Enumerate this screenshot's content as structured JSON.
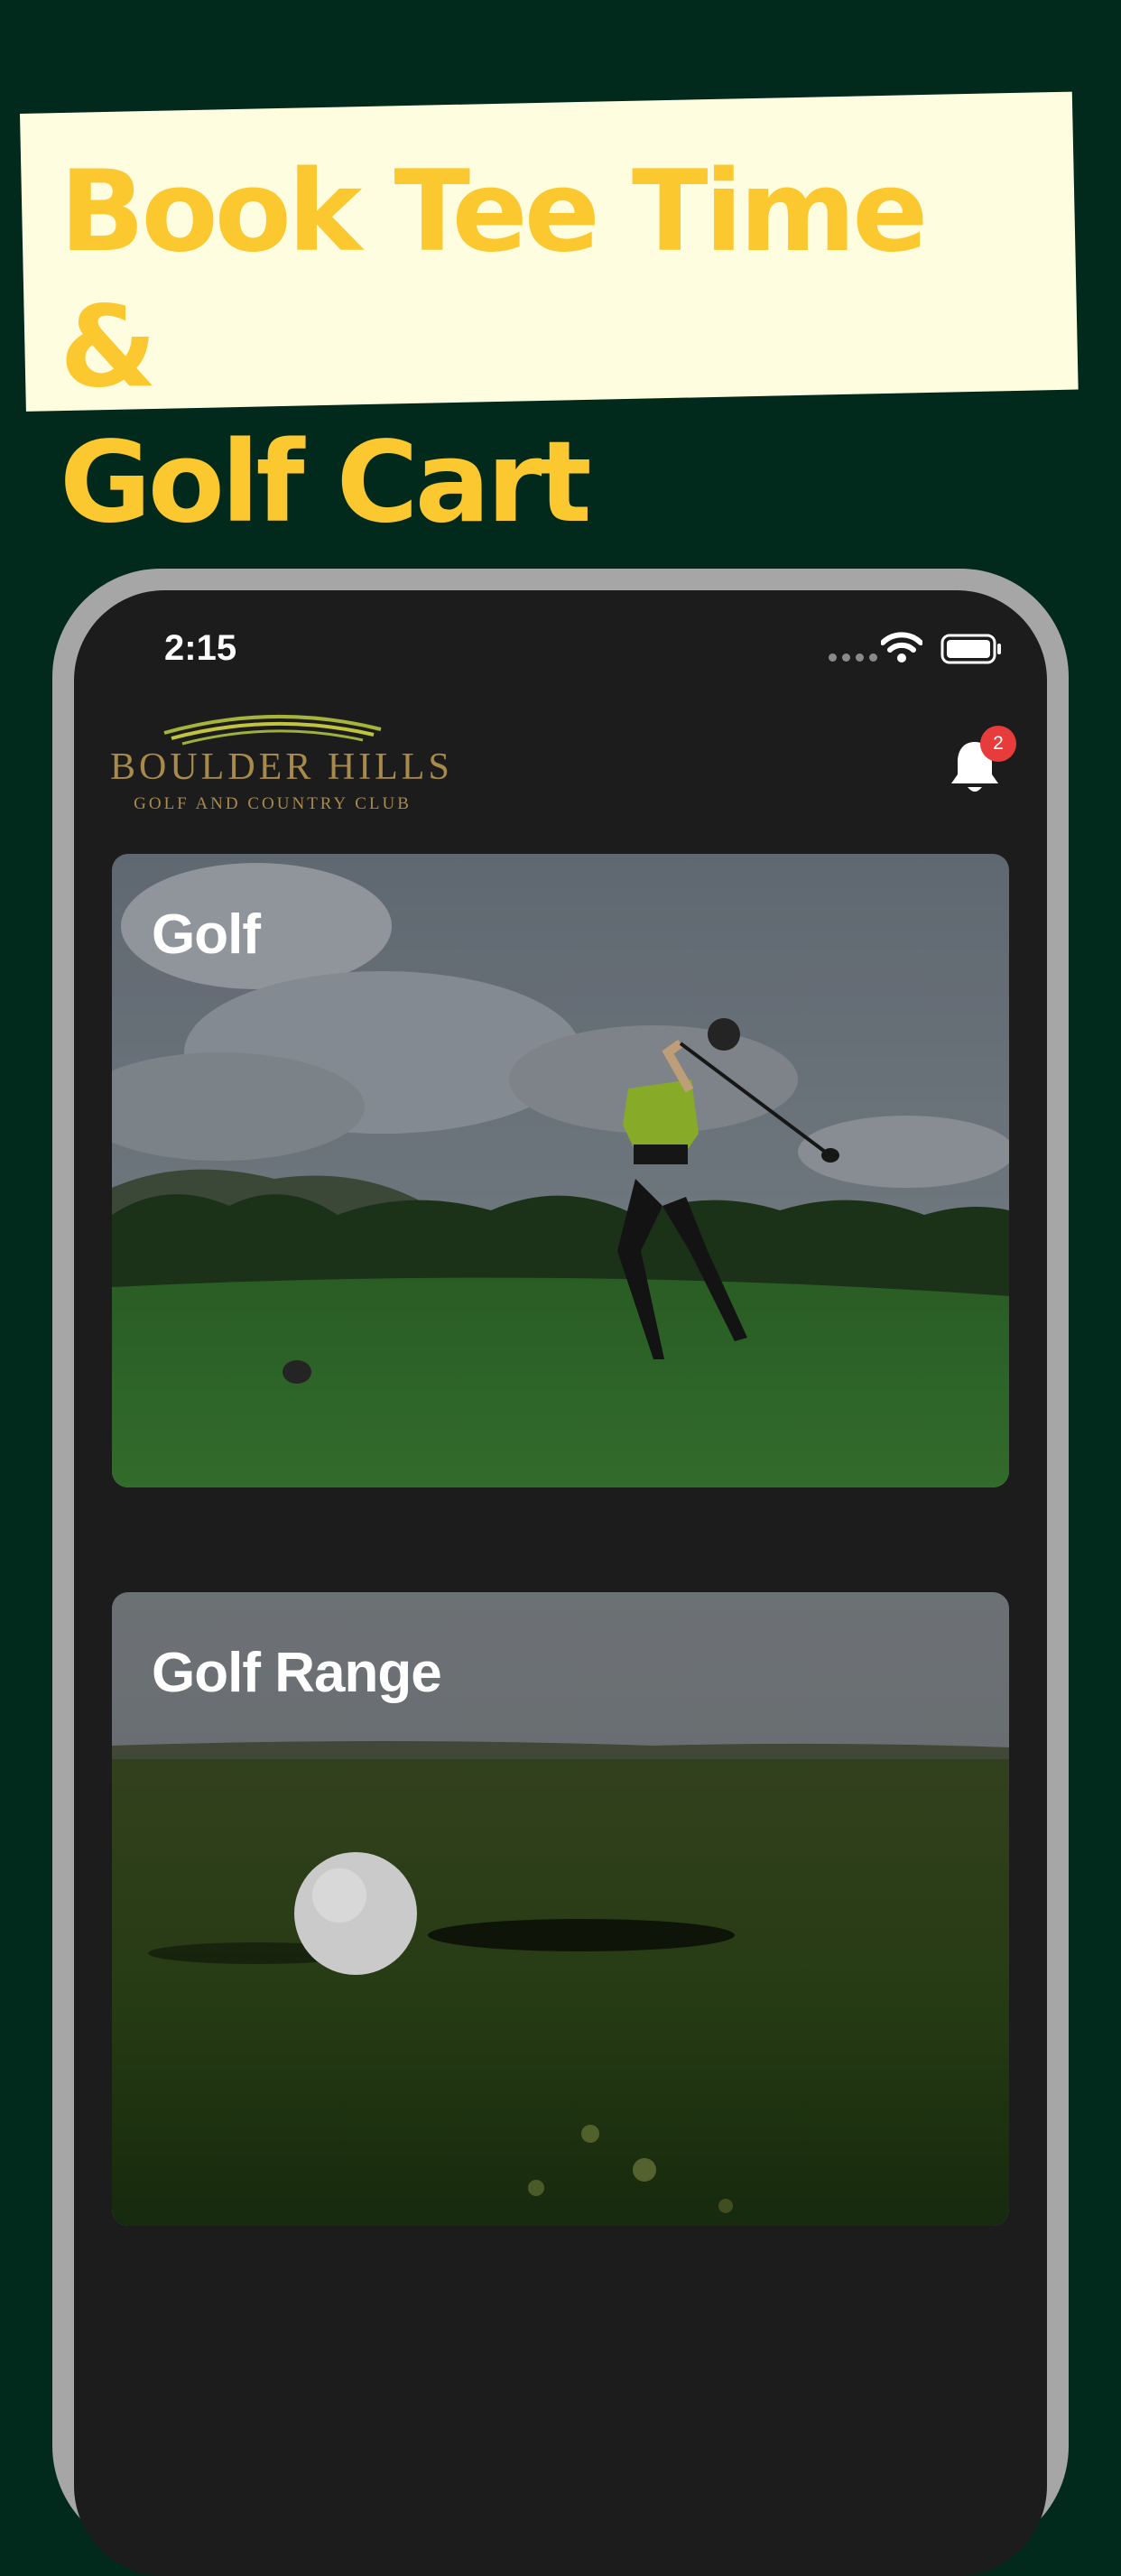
{
  "banner": {
    "headline_line1": "Book Tee Time &",
    "headline_line2": "Golf Cart"
  },
  "status_bar": {
    "time": "2:15"
  },
  "header": {
    "logo_name": "BOULDER HILLS",
    "logo_tagline": "GOLF AND COUNTRY CLUB",
    "notification_count": "2"
  },
  "cards": [
    {
      "title": "Golf"
    },
    {
      "title": "Golf Range"
    }
  ],
  "colors": {
    "page_background": "#012a1d",
    "banner_background": "#fffde0",
    "headline": "#fbc830",
    "screen_background": "#1c1c1c",
    "logo_gold": "#a88a4c",
    "badge": "#e83b3b"
  }
}
